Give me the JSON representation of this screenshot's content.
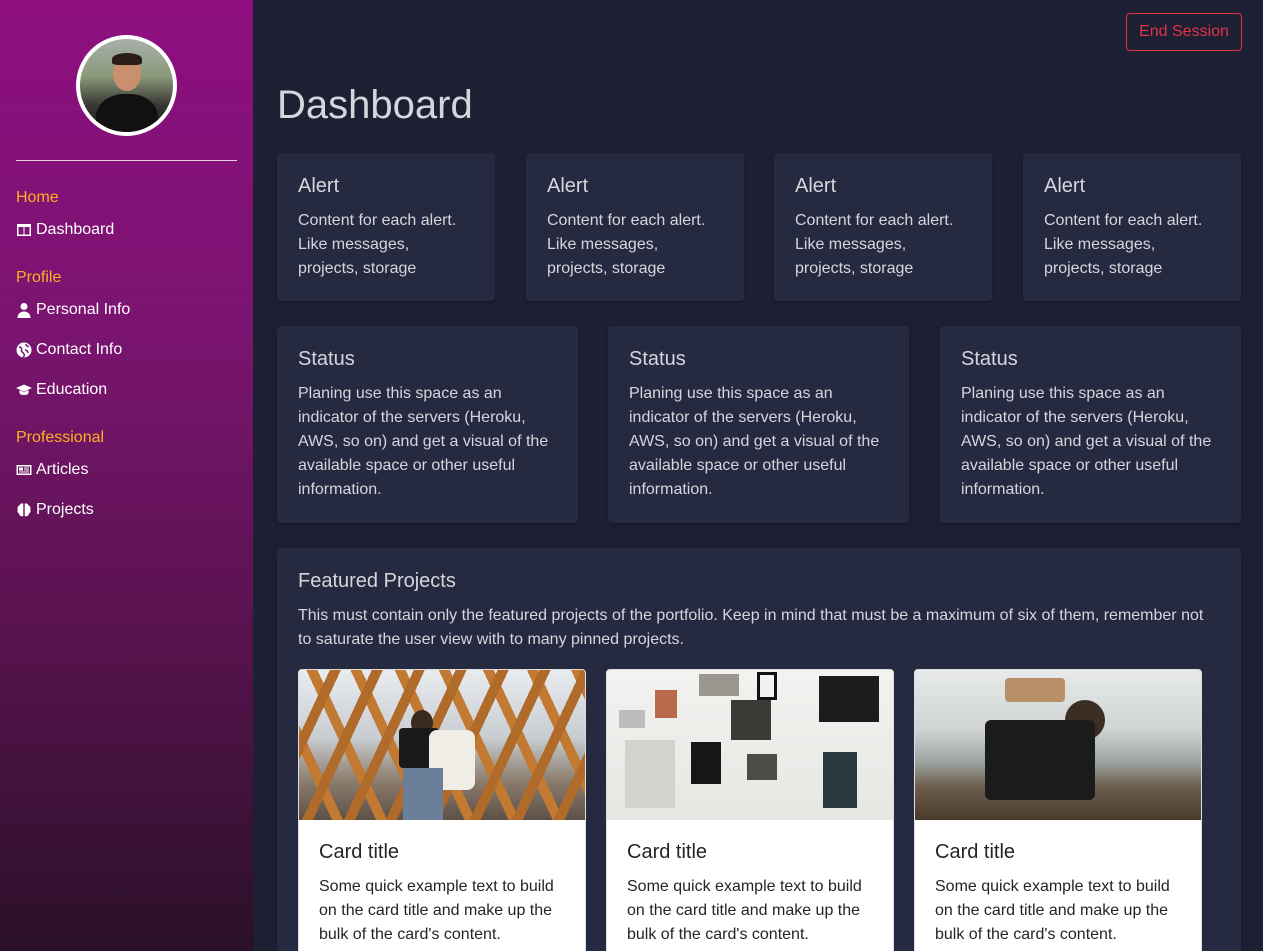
{
  "session": {
    "end_label": "End Session"
  },
  "sidebar": {
    "sections": [
      {
        "heading": "Home",
        "items": [
          {
            "label": "Dashboard",
            "icon": "columns-icon"
          }
        ]
      },
      {
        "heading": "Profile",
        "items": [
          {
            "label": "Personal Info",
            "icon": "user-icon"
          },
          {
            "label": "Contact Info",
            "icon": "globe-icon"
          },
          {
            "label": "Education",
            "icon": "graduation-cap-icon"
          }
        ]
      },
      {
        "heading": "Professional",
        "items": [
          {
            "label": "Articles",
            "icon": "newspaper-icon"
          },
          {
            "label": "Projects",
            "icon": "brain-icon"
          }
        ]
      }
    ]
  },
  "main": {
    "title": "Dashboard",
    "alerts": [
      {
        "title": "Alert",
        "text": "Content for each alert. Like messages, projects, storage"
      },
      {
        "title": "Alert",
        "text": "Content for each alert. Like messages, projects, storage"
      },
      {
        "title": "Alert",
        "text": "Content for each alert. Like messages, projects, storage"
      },
      {
        "title": "Alert",
        "text": "Content for each alert. Like messages, projects, storage"
      }
    ],
    "statuses": [
      {
        "title": "Status",
        "text": "Planing use this space as an indicator of the servers (Heroku, AWS, so on) and get a visual of the available space or other useful information."
      },
      {
        "title": "Status",
        "text": "Planing use this space as an indicator of the servers (Heroku, AWS, so on) and get a visual of the available space or other useful information."
      },
      {
        "title": "Status",
        "text": "Planing use this space as an indicator of the servers (Heroku, AWS, so on) and get a visual of the available space or other useful information."
      }
    ],
    "featured": {
      "title": "Featured Projects",
      "description": "This must contain only the featured projects of the portfolio. Keep in mind that must be a maximum of six of them, remember not to saturate the user view with to many pinned projects.",
      "cards": [
        {
          "title": "Card title",
          "text": "Some quick example text to build on the card title and make up the bulk of the card's content."
        },
        {
          "title": "Card title",
          "text": "Some quick example text to build on the card title and make up the bulk of the card's content."
        },
        {
          "title": "Card title",
          "text": "Some quick example text to build on the card title and make up the bulk of the card's content."
        }
      ]
    }
  },
  "colors": {
    "accent_heading": "#ffb020",
    "danger": "#dc3545",
    "panel": "#262a40",
    "background": "#1f1f33"
  }
}
